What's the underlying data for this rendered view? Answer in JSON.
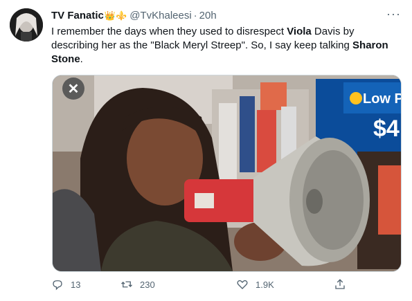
{
  "user": {
    "name": "TV Fanatic",
    "emoji": "👑⚜️",
    "handle": "@TvKhaleesi",
    "separator": "·",
    "time": "20h"
  },
  "more_label": "···",
  "tweet": {
    "p1": "I remember the days when they used to disrespect ",
    "b1": "Viola",
    "p2": " Davis by describing her as the \"Black Meryl Streep\". So, I say keep talking ",
    "b2": "Sharon Stone",
    "p3": "."
  },
  "media": {
    "close_label": "✕",
    "sign_text": "Low P",
    "price_text": "$4"
  },
  "actions": {
    "replies": "13",
    "retweets": "230",
    "likes": "1.9K"
  },
  "icons": {
    "reply": "reply-icon",
    "retweet": "retweet-icon",
    "like": "heart-icon",
    "share": "share-icon"
  }
}
